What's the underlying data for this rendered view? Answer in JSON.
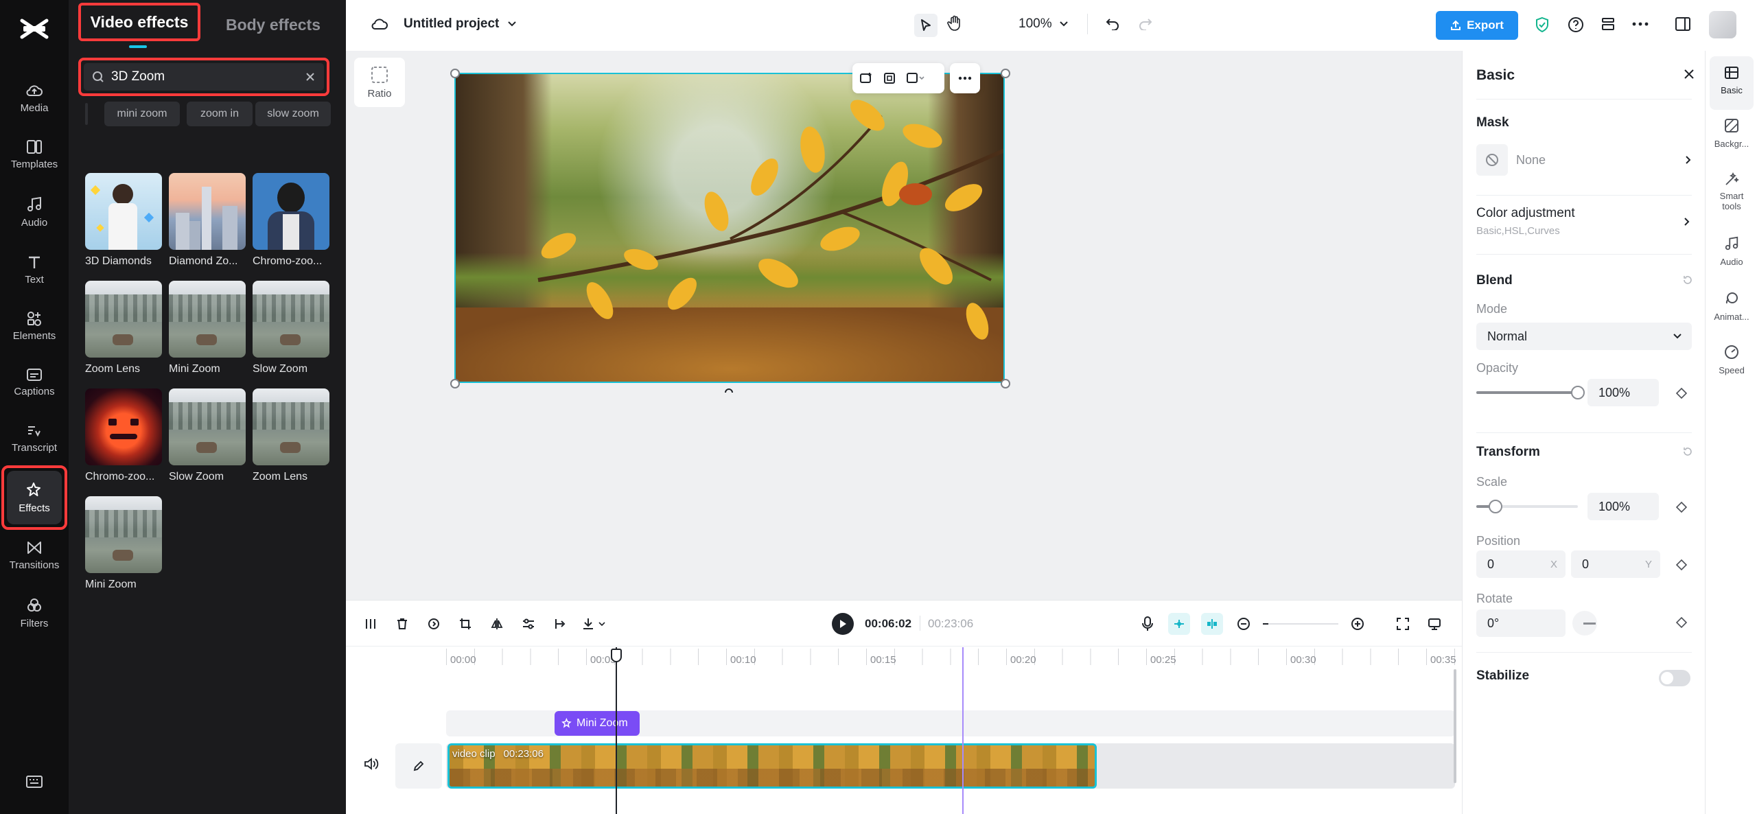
{
  "left_nav": {
    "items": [
      {
        "id": "media",
        "label": "Media"
      },
      {
        "id": "templates",
        "label": "Templates"
      },
      {
        "id": "audio",
        "label": "Audio"
      },
      {
        "id": "text",
        "label": "Text"
      },
      {
        "id": "elements",
        "label": "Elements"
      },
      {
        "id": "captions",
        "label": "Captions"
      },
      {
        "id": "transcript",
        "label": "Transcript"
      },
      {
        "id": "effects",
        "label": "Effects"
      },
      {
        "id": "transitions",
        "label": "Transitions"
      },
      {
        "id": "filters",
        "label": "Filters"
      }
    ],
    "active": "effects"
  },
  "effects_panel": {
    "tabs": [
      "Video effects",
      "Body effects"
    ],
    "active_tab": "Video effects",
    "search_value": "3D Zoom",
    "suggestions": [
      "mini zoom",
      "zoom in",
      "slow zoom"
    ],
    "results": [
      {
        "label": "3D Diamonds"
      },
      {
        "label": "Diamond Zo..."
      },
      {
        "label": "Chromo-zoo..."
      },
      {
        "label": "Zoom Lens"
      },
      {
        "label": "Mini Zoom"
      },
      {
        "label": "Slow Zoom"
      },
      {
        "label": "Chromo-zoo..."
      },
      {
        "label": "Slow Zoom"
      },
      {
        "label": "Zoom Lens"
      },
      {
        "label": "Mini Zoom"
      }
    ]
  },
  "topbar": {
    "project_name": "Untitled project",
    "zoom": "100%",
    "export_label": "Export"
  },
  "canvas": {
    "ratio_label": "Ratio"
  },
  "timeline": {
    "current_time": "00:06:02",
    "total_time": "00:23:06",
    "ticks": [
      "00:00",
      "00:05",
      "00:10",
      "00:15",
      "00:20",
      "00:25",
      "00:30",
      "00:35"
    ],
    "effect_clip_label": "Mini Zoom",
    "video_clip_label": "video clip",
    "video_clip_duration": "00:23:06"
  },
  "right_panel": {
    "title": "Basic",
    "mask_label": "Mask",
    "mask_value": "None",
    "color_adjustment_label": "Color adjustment",
    "color_adjustment_sub": "Basic,HSL,Curves",
    "blend_label": "Blend",
    "mode_label": "Mode",
    "mode_value": "Normal",
    "opacity_label": "Opacity",
    "opacity_value": "100%",
    "opacity_level": 1.0,
    "transform_label": "Transform",
    "scale_label": "Scale",
    "scale_value": "100%",
    "position_label": "Position",
    "position_x": "0",
    "position_x_axis": "X",
    "position_y": "0",
    "position_y_axis": "Y",
    "rotate_label": "Rotate",
    "rotate_value": "0°",
    "stabilize_label": "Stabilize",
    "stabilize_on": false
  },
  "right_tabs": [
    {
      "label": "Basic"
    },
    {
      "label": "Backgr..."
    },
    {
      "label": "Smart tools"
    },
    {
      "label": "Audio"
    },
    {
      "label": "Animat..."
    },
    {
      "label": "Speed"
    }
  ],
  "colors": {
    "accent": "#1f8ef1",
    "highlight_red": "#ff3b3b",
    "effect_purple": "#7a4cf5",
    "selection_cyan": "#00c2d6"
  }
}
